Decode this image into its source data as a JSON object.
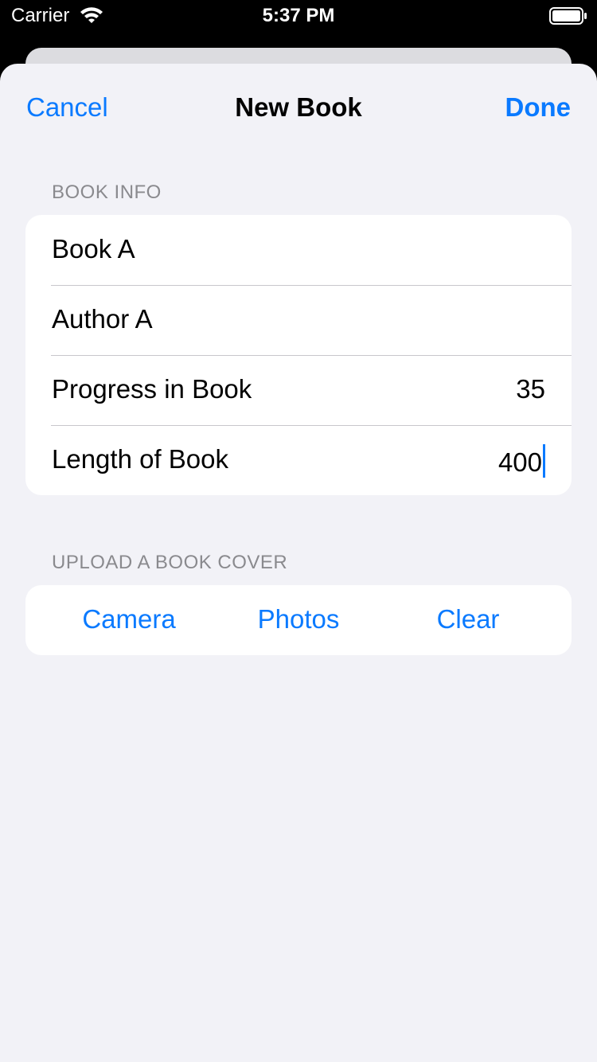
{
  "status_bar": {
    "carrier": "Carrier",
    "time": "5:37 PM"
  },
  "nav": {
    "cancel_label": "Cancel",
    "title": "New Book",
    "done_label": "Done"
  },
  "book_info": {
    "header": "BOOK INFO",
    "title_value": "Book A",
    "author_value": "Author A",
    "progress_label": "Progress in Book",
    "progress_value": "35",
    "length_label": "Length of Book",
    "length_value": "400"
  },
  "cover": {
    "header": "UPLOAD A BOOK COVER",
    "camera_label": "Camera",
    "photos_label": "Photos",
    "clear_label": "Clear"
  },
  "colors": {
    "accent": "#0a7aff",
    "background": "#f2f2f7",
    "secondary_text": "#8a8a8e"
  }
}
